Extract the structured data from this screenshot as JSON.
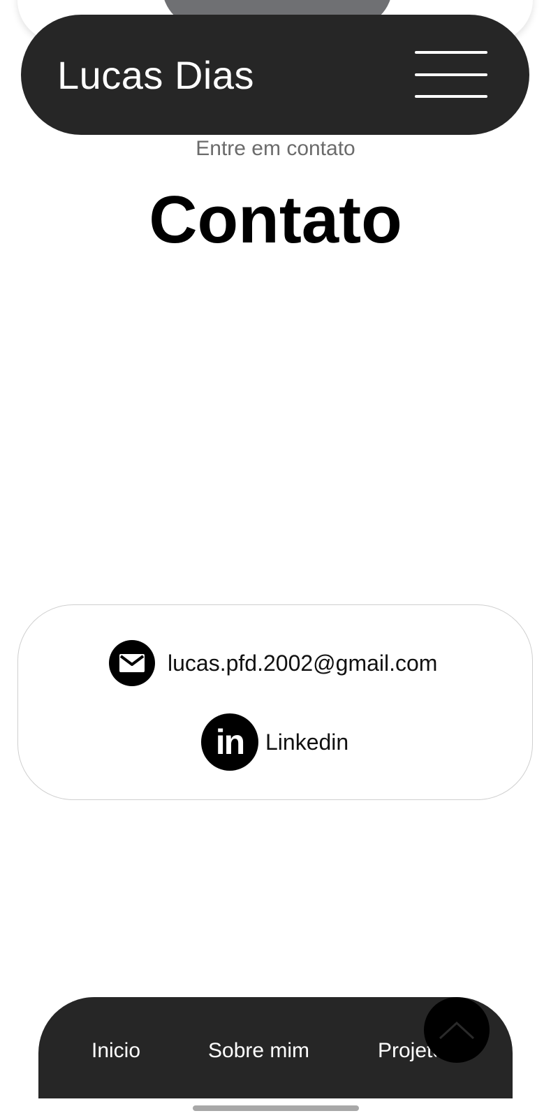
{
  "header": {
    "brand": "Lucas Dias",
    "menu_icon": "hamburger-menu-icon"
  },
  "section": {
    "subtitle": "Entre em contato",
    "title": "Contato"
  },
  "contacts": {
    "email": {
      "icon": "email-icon",
      "label": "lucas.pfd.2002@gmail.com"
    },
    "linkedin": {
      "icon": "linkedin-icon",
      "label": "Linkedin",
      "icon_text": "in"
    }
  },
  "bottom_nav": {
    "items": [
      "Inicio",
      "Sobre mim",
      "Projetos"
    ]
  },
  "scroll_top": {
    "icon": "chevron-up-icon"
  },
  "colors": {
    "dark": "#262626",
    "black": "#000000",
    "muted": "#6b6b6b",
    "border": "#cfcfcf"
  }
}
